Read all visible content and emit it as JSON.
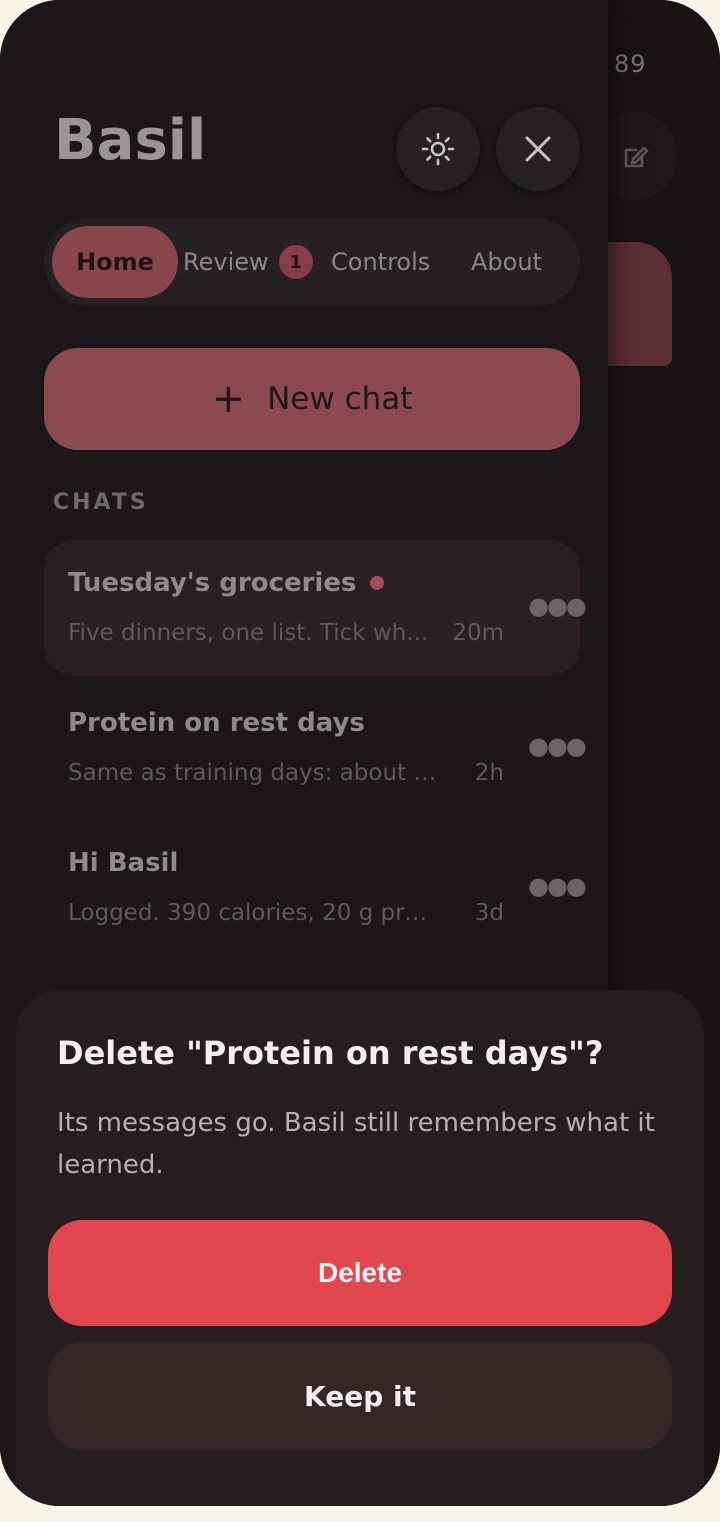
{
  "background": {
    "status_text": "89",
    "compose_icon": "edit-icon"
  },
  "drawer": {
    "title": "Basil",
    "theme_icon": "sun-icon",
    "close_icon": "close-icon",
    "tabs": [
      {
        "label": "Home",
        "active": true
      },
      {
        "label": "Review",
        "badge": "1",
        "active": false
      },
      {
        "label": "Controls",
        "active": false
      },
      {
        "label": "About",
        "active": false
      }
    ],
    "new_chat": {
      "label": "New chat",
      "icon": "plus-icon"
    },
    "section_label": "CHATS",
    "chats": [
      {
        "title": "Tuesday's groceries",
        "preview": "Five dinners, one list. Tick wh...",
        "time": "20m",
        "unread": true,
        "selected": true
      },
      {
        "title": "Protein on rest days",
        "preview": "Same as training days: about 1...",
        "time": "2h",
        "unread": false,
        "selected": false
      },
      {
        "title": "Hi Basil",
        "preview": "Logged. 390 calories, 20 g prot...",
        "time": "3d",
        "unread": false,
        "selected": false
      }
    ]
  },
  "sheet": {
    "title": "Delete \"Protein on rest days\"?",
    "body": "Its messages go. Basil still remembers what it learned.",
    "delete_label": "Delete",
    "keep_label": "Keep it"
  },
  "colors": {
    "accent": "#8a464d",
    "danger": "#e2464f",
    "unread": "#a64a55"
  }
}
